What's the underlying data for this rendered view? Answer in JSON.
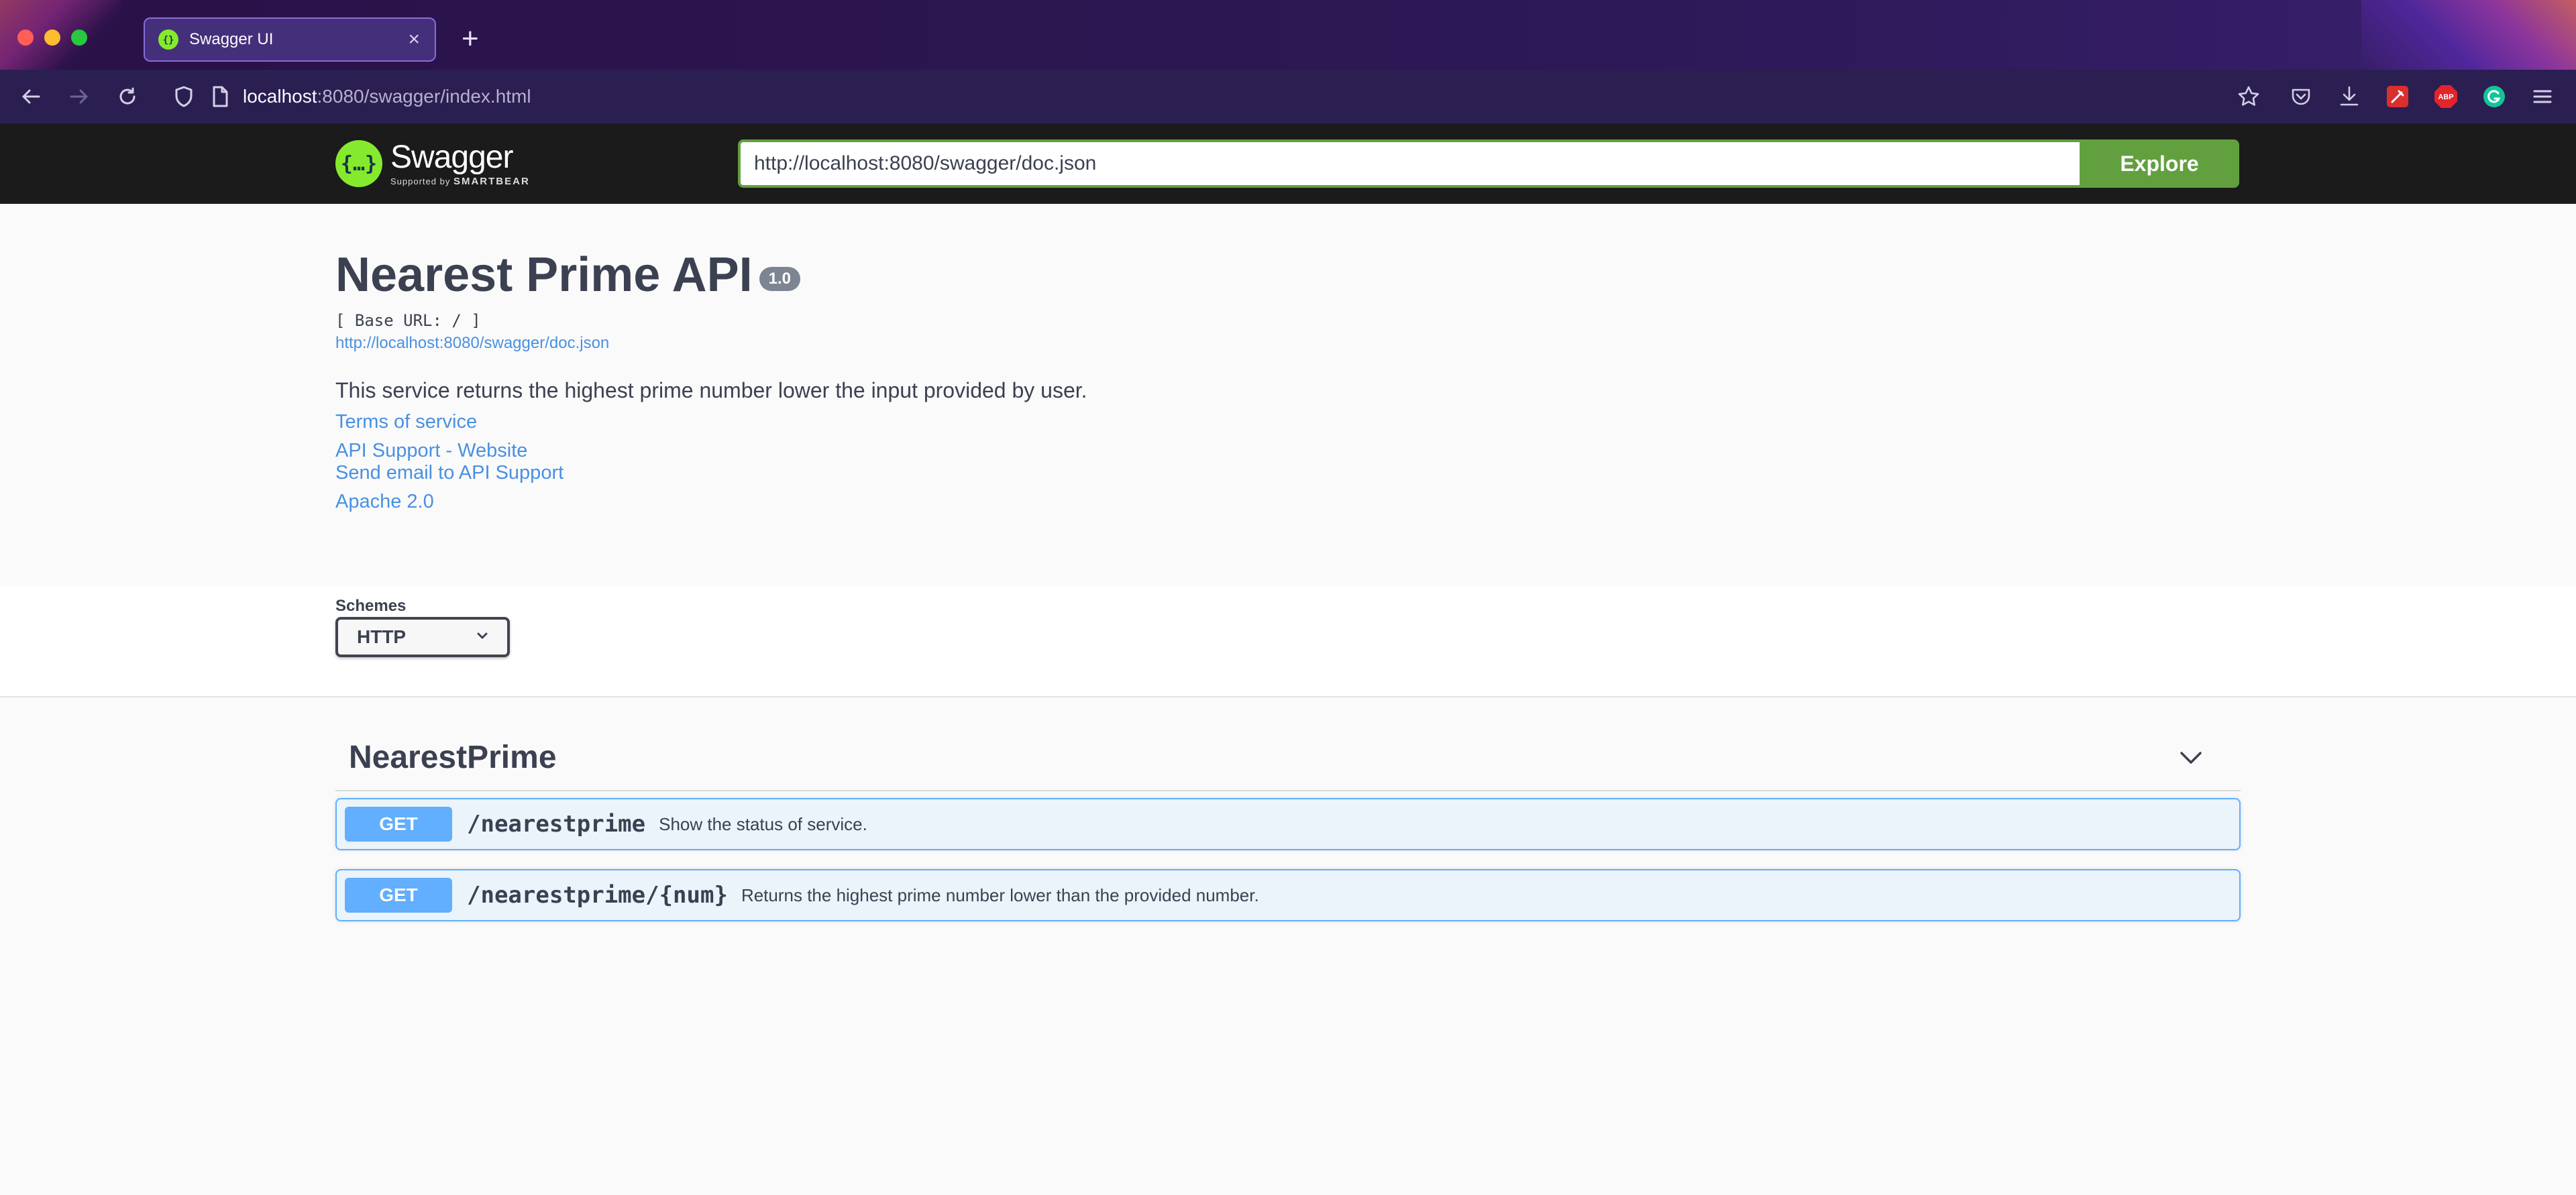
{
  "browser": {
    "tab_title": "Swagger UI",
    "close_glyph": "×",
    "newtab_glyph": "+",
    "url_host": "localhost",
    "url_rest": ":8080/swagger/index.html",
    "icons": [
      "back-icon",
      "forward-icon",
      "reload-icon",
      "shield-icon",
      "page-icon",
      "bookmark-star-icon",
      "pocket-icon",
      "download-icon",
      "extension-icon",
      "adblock-icon",
      "grammarly-icon",
      "menu-icon"
    ],
    "abp_label": "ABP"
  },
  "topbar": {
    "logo_glyph": "{…}",
    "brand": "Swagger",
    "supported_by": "Supported by",
    "smartbear": "SMARTBEAR",
    "spec_url": "http://localhost:8080/swagger/doc.json",
    "explore_label": "Explore",
    "accent": "#62a03f"
  },
  "info": {
    "title": "Nearest Prime API",
    "version": "1.0",
    "base_url": "[ Base URL: / ]",
    "doc_link": "http://localhost:8080/swagger/doc.json",
    "description": "This service returns the highest prime number lower the input provided by user.",
    "links": {
      "terms": "Terms of service",
      "website": "API Support - Website",
      "email": "Send email to API Support",
      "license": "Apache 2.0"
    }
  },
  "schemes": {
    "label": "Schemes",
    "selected": "HTTP"
  },
  "tag": {
    "name": "NearestPrime",
    "operations": [
      {
        "method": "GET",
        "path": "/nearestprime",
        "summary": "Show the status of service."
      },
      {
        "method": "GET",
        "path": "/nearestprime/{num}",
        "summary": "Returns the highest prime number lower than the provided number."
      }
    ],
    "method_color": "#61affe"
  }
}
